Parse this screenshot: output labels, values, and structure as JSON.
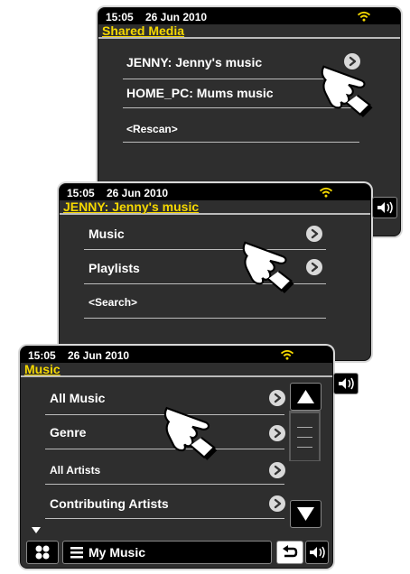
{
  "panel1": {
    "time": "15:05",
    "date": "26 Jun 2010",
    "title": "Shared Media",
    "items": [
      {
        "label": "JENNY: Jenny's music"
      },
      {
        "label": "HOME_PC: Mums music"
      },
      {
        "label": "<Rescan>"
      }
    ]
  },
  "panel2": {
    "time": "15:05",
    "date": "26 Jun 2010",
    "title": "JENNY: Jenny's music",
    "items": [
      {
        "label": "Music"
      },
      {
        "label": "Playlists"
      },
      {
        "label": "<Search>"
      }
    ]
  },
  "panel3": {
    "time": "15:05",
    "date": "26 Jun 2010",
    "title": "Music",
    "items": [
      {
        "label": "All Music"
      },
      {
        "label": "Genre"
      },
      {
        "label": "All Artists"
      },
      {
        "label": "Contributing Artists"
      }
    ],
    "bottom_label": "My Music"
  },
  "colors": {
    "accent": "#f5d800",
    "screen_bg": "#2e2e2e",
    "statusbar_bg": "#000000"
  },
  "icons": [
    "wifi-icon",
    "chevron-right-icon",
    "up-arrow-icon",
    "down-arrow-icon",
    "grid-menu-icon",
    "list-icon",
    "back-icon",
    "volume-icon",
    "pointing-hand-icon"
  ]
}
